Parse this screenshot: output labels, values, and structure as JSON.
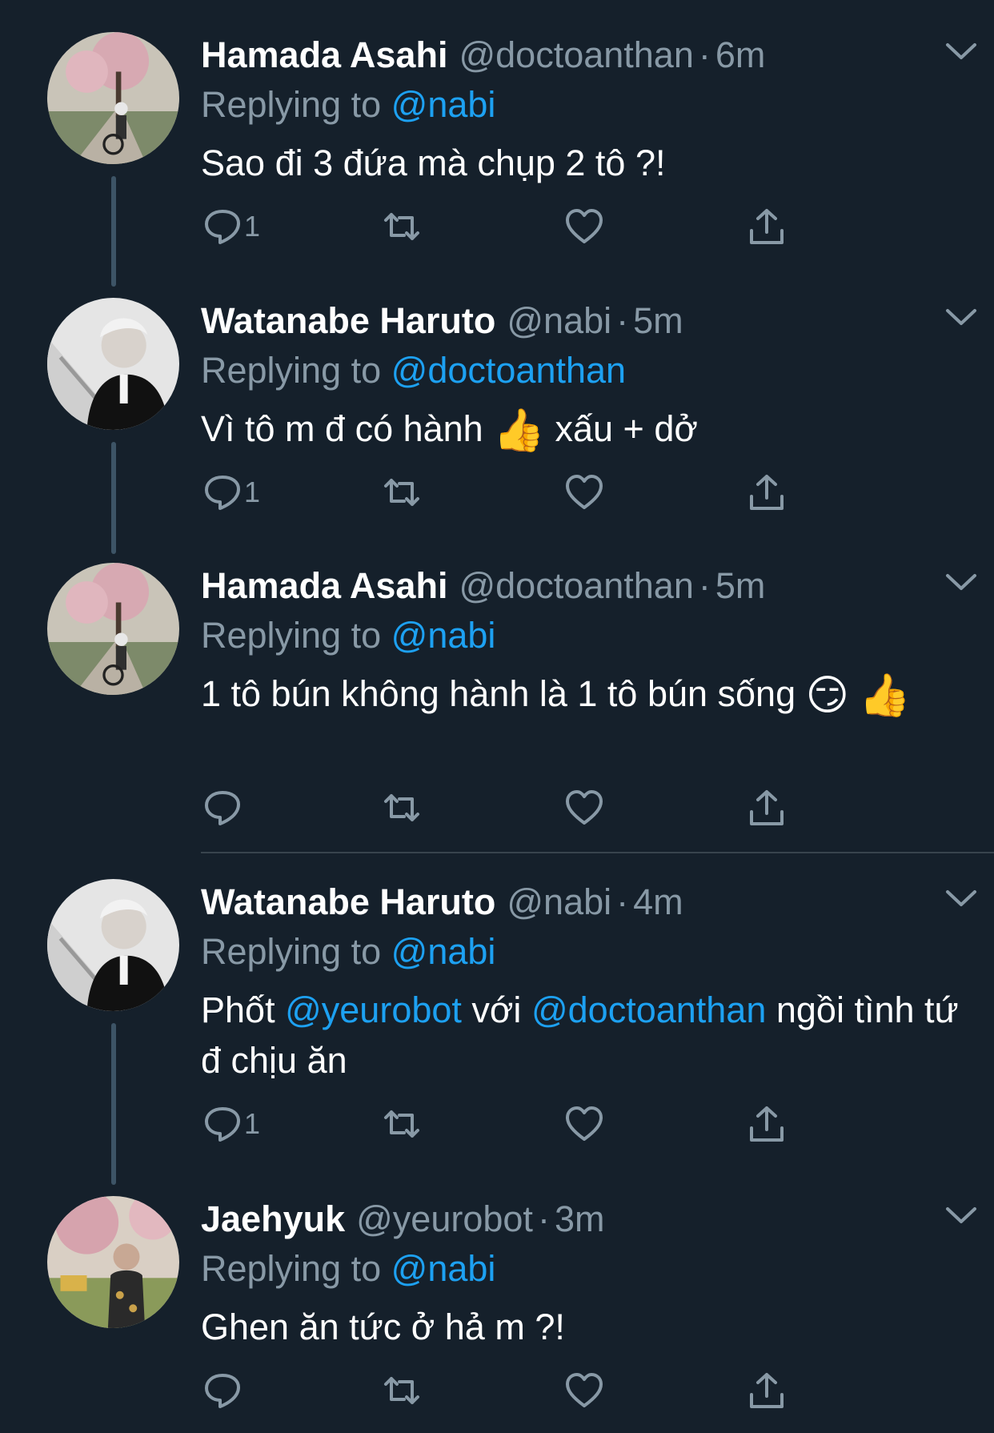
{
  "tweets": [
    {
      "name": "Hamada Asahi",
      "handle": "@doctoanthan",
      "dot": "·",
      "time": "6m",
      "replying_prefix": "Replying to",
      "replying_to": "@nabi",
      "text": "Sao đi 3 đứa mà chụp 2 tô ?!",
      "reply_count": "1",
      "avatar_icon": "avatar-cherry-blossom-cyclist"
    },
    {
      "name": "Watanabe Haruto",
      "handle": "@nabi",
      "dot": "·",
      "time": "5m",
      "replying_prefix": "Replying to",
      "replying_to": "@doctoanthan",
      "text_before": "Vì tô m đ có hành",
      "emoji": "👍",
      "text_after": "xấu + dở",
      "reply_count": "1",
      "avatar_icon": "avatar-monochrome-portrait"
    },
    {
      "name": "Hamada Asahi",
      "handle": "@doctoanthan",
      "dot": "·",
      "time": "5m",
      "replying_prefix": "Replying to",
      "replying_to": "@nabi",
      "text": "1 tô bún không hành là 1 tô bún sống",
      "emoji1": "😏",
      "emoji2": "👍",
      "reply_count": "",
      "avatar_icon": "avatar-cherry-blossom-cyclist"
    },
    {
      "name": "Watanabe Haruto",
      "handle": "@nabi",
      "dot": "·",
      "time": "4m",
      "replying_prefix": "Replying to",
      "replying_to": "@nabi",
      "text_start": "Phốt",
      "mention1": "@yeurobot",
      "text_mid": "với",
      "mention2": "@doctoanthan",
      "text_end": "ngồi tình tứ đ chịu ăn",
      "reply_count": "1",
      "avatar_icon": "avatar-monochrome-portrait"
    },
    {
      "name": "Jaehyuk",
      "handle": "@yeurobot",
      "dot": "·",
      "time": "3m",
      "replying_prefix": "Replying to",
      "replying_to": "@nabi",
      "text": "Ghen ăn tức ở hả m ?!",
      "reply_count": "",
      "avatar_icon": "avatar-park-portrait"
    }
  ],
  "colors": {
    "background": "#15202b",
    "secondary_text": "#8899a6",
    "accent": "#1da1f2",
    "thread_line": "#3d5466"
  }
}
